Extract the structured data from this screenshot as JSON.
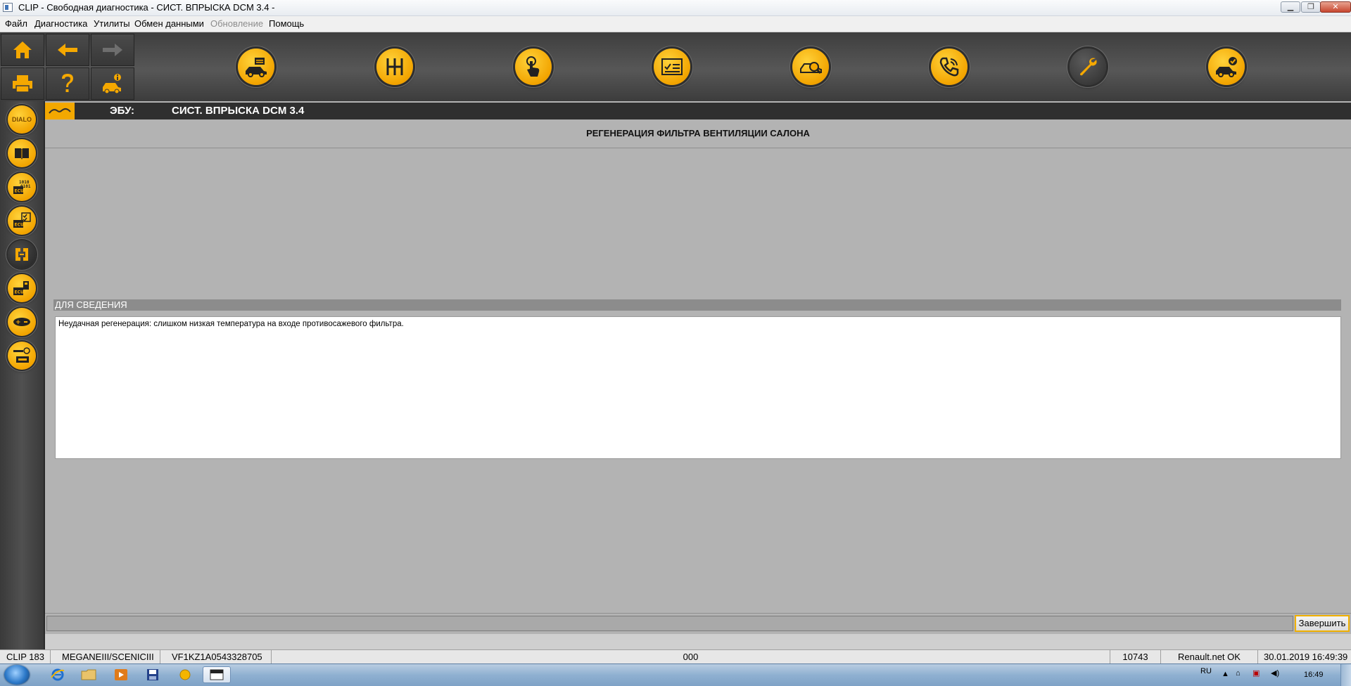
{
  "window": {
    "title": "CLIP - Свободная диагностика - СИСТ. ВПРЫСКА DCM 3.4 -",
    "minimize": "▁",
    "restore": "❐",
    "close": "✕"
  },
  "menu": {
    "items": [
      {
        "label": "Файл",
        "enabled": true
      },
      {
        "label": "Диагностика",
        "enabled": true
      },
      {
        "label": "Утилиты",
        "enabled": true
      },
      {
        "label": "Обмен данными",
        "enabled": true
      },
      {
        "label": "Обновление",
        "enabled": false
      },
      {
        "label": "Помощь",
        "enabled": true
      }
    ]
  },
  "toolbar": {
    "nav_icons": [
      "home-icon",
      "back-arrow-icon",
      "forward-arrow-icon",
      "print-icon",
      "help-icon",
      "vehicle-info-icon"
    ],
    "main_icons": [
      "vehicle-identification-icon",
      "gearbox-icon",
      "touch-icon",
      "checklist-icon",
      "vehicle-scan-icon",
      "phone-support-icon",
      "wrench-icon",
      "vehicle-check-icon"
    ],
    "active_main": "wrench-icon"
  },
  "sidebar": {
    "dialo_label": "DIALO",
    "icons": [
      "dialo-icon",
      "book-icon",
      "ecu-binary-icon",
      "ecu-checklist-icon",
      "connector-icon",
      "ecu-config-icon",
      "plus-minus-icon",
      "meter-icon"
    ],
    "active": "connector-icon"
  },
  "ecu": {
    "label": "ЭБУ:",
    "value": "СИСТ. ВПРЫСКА DCM 3.4"
  },
  "procedure": {
    "title": "РЕГЕНЕРАЦИЯ ФИЛЬТРА ВЕНТИЛЯЦИИ САЛОНА"
  },
  "info": {
    "header": "ДЛЯ СВЕДЕНИЯ",
    "message": "Неудачная регенерация: слишком низкая температура на входе противосажевого фильтра."
  },
  "actions": {
    "finish_label": "Завершить"
  },
  "status": {
    "clip": "CLIP 183",
    "vehicle": "MEGANEIII/SCENICIII",
    "vin": "VF1KZ1A0543328705",
    "code": "000",
    "number": "10743",
    "network": "Renault.net OK",
    "datetime": "30.01.2019 16:49:39"
  },
  "taskbar": {
    "apps": [
      "ie-icon",
      "explorer-icon",
      "media-player-icon",
      "save-icon",
      "clip-yellow-icon",
      "clip-window-icon"
    ],
    "active_app": "clip-window-icon",
    "language": "RU",
    "clock": "16:49"
  }
}
